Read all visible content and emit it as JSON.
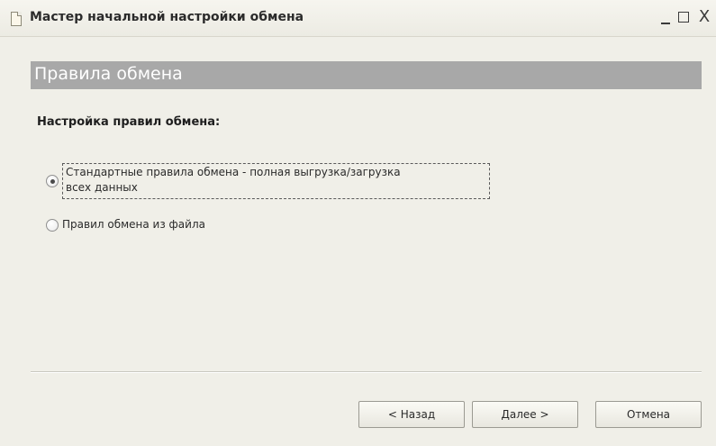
{
  "window": {
    "title": "Мастер начальной настройки обмена",
    "controls": {
      "minimize_icon": "minimize-icon",
      "maximize_icon": "maximize-icon",
      "close_label": "X"
    }
  },
  "header": {
    "title": "Правила обмена"
  },
  "settings": {
    "label": "Настройка правил обмена:",
    "options": [
      {
        "label_line1": "Стандартные правила обмена - полная выгрузка/загрузка",
        "label_line2": "всех данных",
        "selected": true
      },
      {
        "label": "Правил обмена из файла",
        "selected": false
      }
    ]
  },
  "footer": {
    "back_label": "< Назад",
    "next_label": "Далее >",
    "cancel_label": "Отмена"
  },
  "colors": {
    "header_band": "#a8a8a8",
    "window_bg": "#f0efe8"
  }
}
